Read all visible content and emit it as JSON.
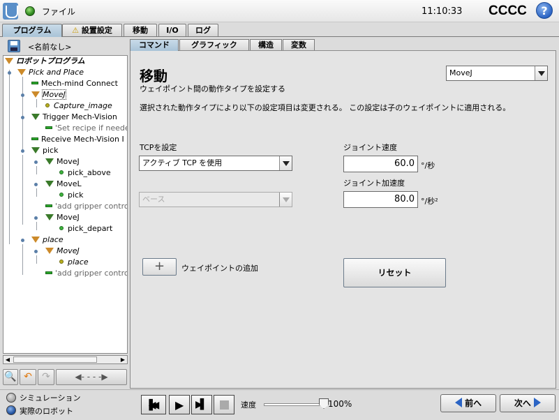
{
  "topbar": {
    "file_label": "ファイル",
    "clock": "11:10:33",
    "robot_name": "CCCC",
    "help": "?"
  },
  "main_tabs": [
    "プログラム",
    "設置設定",
    "移動",
    "I/O",
    "ログ"
  ],
  "program": {
    "name": "<名前なし>"
  },
  "tree": [
    {
      "text": "ロボットプログラム"
    },
    {
      "text": "Pick and Place"
    },
    {
      "text": "Mech-mind Connect"
    },
    {
      "text": "MoveJ"
    },
    {
      "text": "Capture_image"
    },
    {
      "text": "Trigger Mech-Vision"
    },
    {
      "text": "'Set recipe if neede"
    },
    {
      "text": "Receive Mech-Vision I"
    },
    {
      "text": "pick"
    },
    {
      "text": "MoveJ"
    },
    {
      "text": "pick_above"
    },
    {
      "text": "MoveL"
    },
    {
      "text": "pick"
    },
    {
      "text": "'add gripper contro"
    },
    {
      "text": "MoveJ"
    },
    {
      "text": "pick_depart"
    },
    {
      "text": "place"
    },
    {
      "text": "MoveJ"
    },
    {
      "text": "place"
    },
    {
      "text": "'add gripper contro"
    }
  ],
  "content_tabs": [
    "コマンド",
    "グラフィック",
    "構造",
    "変数"
  ],
  "move": {
    "title": "移動",
    "subtitle": "ウェイポイント間の動作タイプを設定する",
    "description": "選択された動作タイプにより以下の設定項目は変更される。 この設定は子のウェイポイントに適用される。",
    "type_value": "MoveJ",
    "tcp_label": "TCPを設定",
    "tcp_value": "アクティブ TCP を使用",
    "feature_value": "ベース",
    "joint_speed_label": "ジョイント速度",
    "joint_speed_value": "60.0",
    "joint_speed_unit": "°/秒",
    "joint_accel_label": "ジョイント加速度",
    "joint_accel_value": "80.0",
    "joint_accel_unit": "°/秒²",
    "add_waypoint_label": "ウェイポイントの追加",
    "reset_label": "リセット"
  },
  "bottom": {
    "simulation": "シミュレーション",
    "real_robot": "実際のロボット",
    "speed_label": "速度",
    "speed_value": "100%",
    "speed_fraction": 1.0,
    "prev": "前へ",
    "next": "次へ"
  },
  "colors": {
    "accent_tab": "#b6cde0",
    "tree_folder": "#cc8a2a",
    "waypoint": "#b9b020",
    "command": "#2ca82c"
  }
}
